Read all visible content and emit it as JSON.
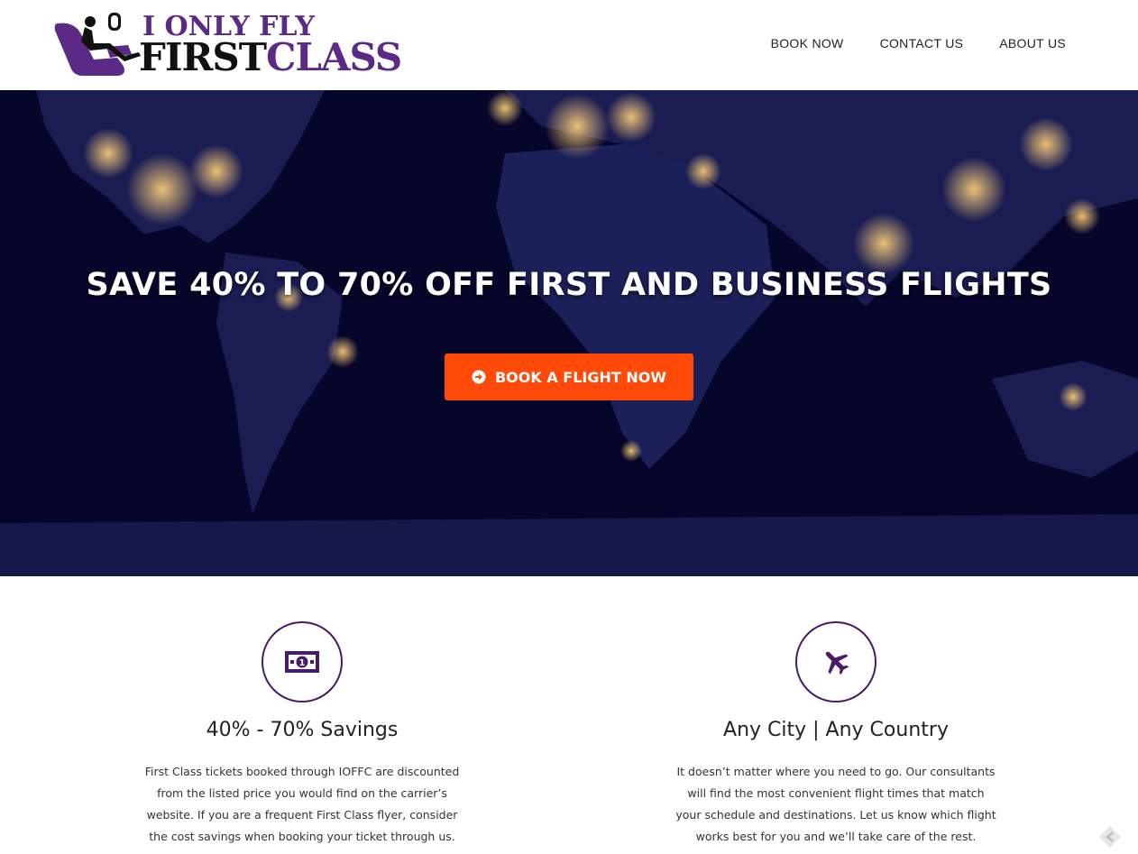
{
  "brand": {
    "line1": "I ONLY FLY",
    "line2_first": "FIRST",
    "line2_class": "CLASS",
    "logo_icon": "reclining-seat-icon",
    "primary_color": "#5b2a86"
  },
  "nav": {
    "items": [
      {
        "label": "BOOK NOW"
      },
      {
        "label": "CONTACT US"
      },
      {
        "label": "ABOUT US"
      }
    ]
  },
  "hero": {
    "title": "SAVE 40% TO 70% OFF FIRST AND BUSINESS FLIGHTS",
    "cta_label": "BOOK A FLIGHT NOW",
    "cta_icon": "arrow-circle-right-icon",
    "cta_color": "#ff4a0a",
    "background": "night-earth-map"
  },
  "features": [
    {
      "icon": "money-bill-icon",
      "title": "40% - 70% Savings",
      "text": "First Class tickets booked through IOFFC are discounted from the listed price you would find on the carrier’s website. If you are a frequent First Class flyer, consider the cost savings when booking your ticket through us."
    },
    {
      "icon": "airplane-icon",
      "title": "Any City | Any Country",
      "text": "It doesn’t matter where you need to go. Our consultants will find the most convenient flight times that match your schedule and destinations. Let us know which flight works best for you and we’ll take care of the rest."
    }
  ],
  "accent_color": "#4a1a6a"
}
